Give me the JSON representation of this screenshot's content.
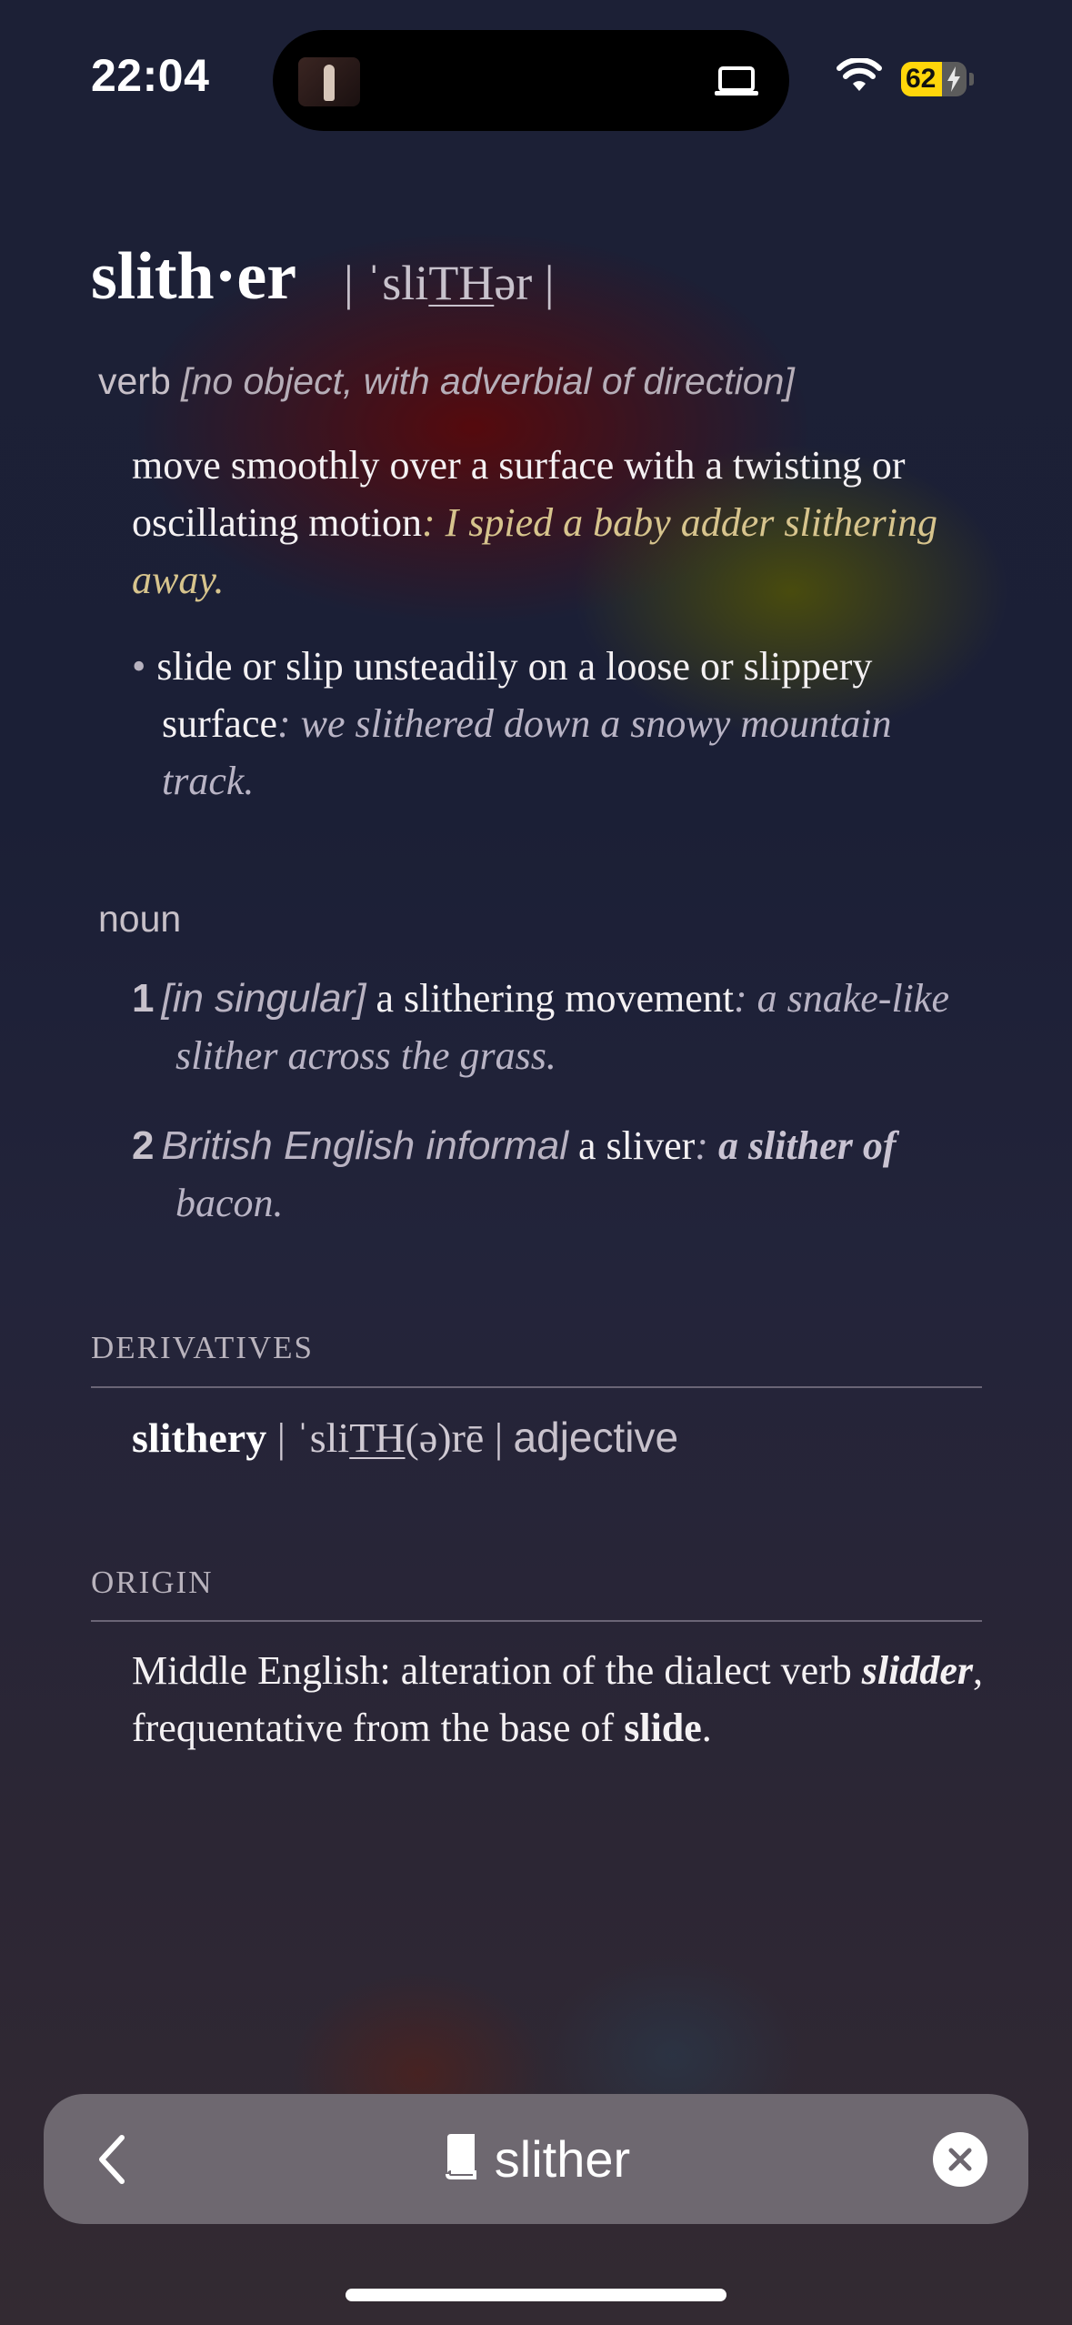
{
  "status_bar": {
    "time": "22:04",
    "battery_level": "62",
    "battery_fraction": 0.62,
    "charging": true
  },
  "entry": {
    "headword": "slith·er",
    "pronunciation_open": "| ˈsli",
    "pronunciation_th": "TH",
    "pronunciation_close": "ər |"
  },
  "verb_section": {
    "pos": "verb",
    "qualifier": "[no object, with adverbial of direction]",
    "sense1_def": "move smoothly over a surface with a twisting or oscillating motion",
    "sense1_example": "I spied a baby adder slithering away.",
    "subsense_bullet": "•",
    "subsense_def": "slide or slip unsteadily on a loose or slippery surface",
    "subsense_example": "we slithered down a snowy mountain track."
  },
  "noun_section": {
    "pos": "noun",
    "sense1_number": "1",
    "sense1_qualifier": "[in singular]",
    "sense1_def": "a slithering movement",
    "sense1_example": "a snake-like slither across the grass.",
    "sense2_number": "2",
    "sense2_register": "British English informal",
    "sense2_def": "a sliver",
    "sense2_example_bold": "a slither of",
    "sense2_example_rest": "bacon."
  },
  "derivatives": {
    "heading": "DERIVATIVES",
    "word": "slithery",
    "pron_open": "| ˈsli",
    "pron_th": "TH",
    "pron_close": "(ə)rē |",
    "pos": "adjective"
  },
  "origin": {
    "heading": "ORIGIN",
    "text_1": "Middle English: alteration of the dialect verb ",
    "word_slidder": "slidder",
    "text_2": ", frequentative from the base of ",
    "word_slide": "slide",
    "text_3": "."
  },
  "search_bar": {
    "query": "slither",
    "icons": [
      "chevron-left-icon",
      "book-icon",
      "clear-icon"
    ]
  }
}
